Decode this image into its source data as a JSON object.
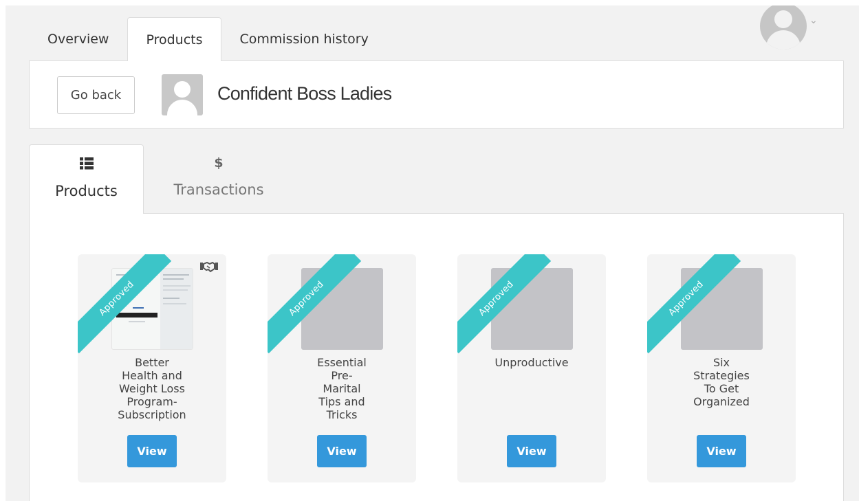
{
  "top_tabs": [
    "Overview",
    "Products",
    "Commission history"
  ],
  "active_top_tab": "Products",
  "header": {
    "back_label": "Go back",
    "store_name": "Confident Boss Ladies"
  },
  "inner_tabs": [
    {
      "label": "Products",
      "icon": "list-icon"
    },
    {
      "label": "Transactions",
      "icon": "dollar-icon",
      "glyph": "$"
    }
  ],
  "badge_text": "Approved",
  "view_label": "View",
  "colors": {
    "ribbon": "#3cc5c8",
    "view_button": "#3498db",
    "background": "#f2f2f2"
  },
  "products": [
    {
      "title_lines": [
        "Better",
        "Health and",
        "Weight Loss",
        "Program-",
        "Subscription"
      ],
      "status": "Approved",
      "has_thumbnail": true,
      "has_affiliate_icon": true
    },
    {
      "title_lines": [
        "Essential",
        "Pre-",
        "Marital",
        "Tips and",
        "Tricks"
      ],
      "status": "Approved",
      "has_thumbnail": false,
      "has_affiliate_icon": false
    },
    {
      "title_lines": [
        "Unproductive"
      ],
      "status": "Approved",
      "has_thumbnail": false,
      "has_affiliate_icon": false
    },
    {
      "title_lines": [
        "Six",
        "Strategies",
        "To Get",
        "Organized"
      ],
      "status": "Approved",
      "has_thumbnail": false,
      "has_affiliate_icon": false
    }
  ]
}
